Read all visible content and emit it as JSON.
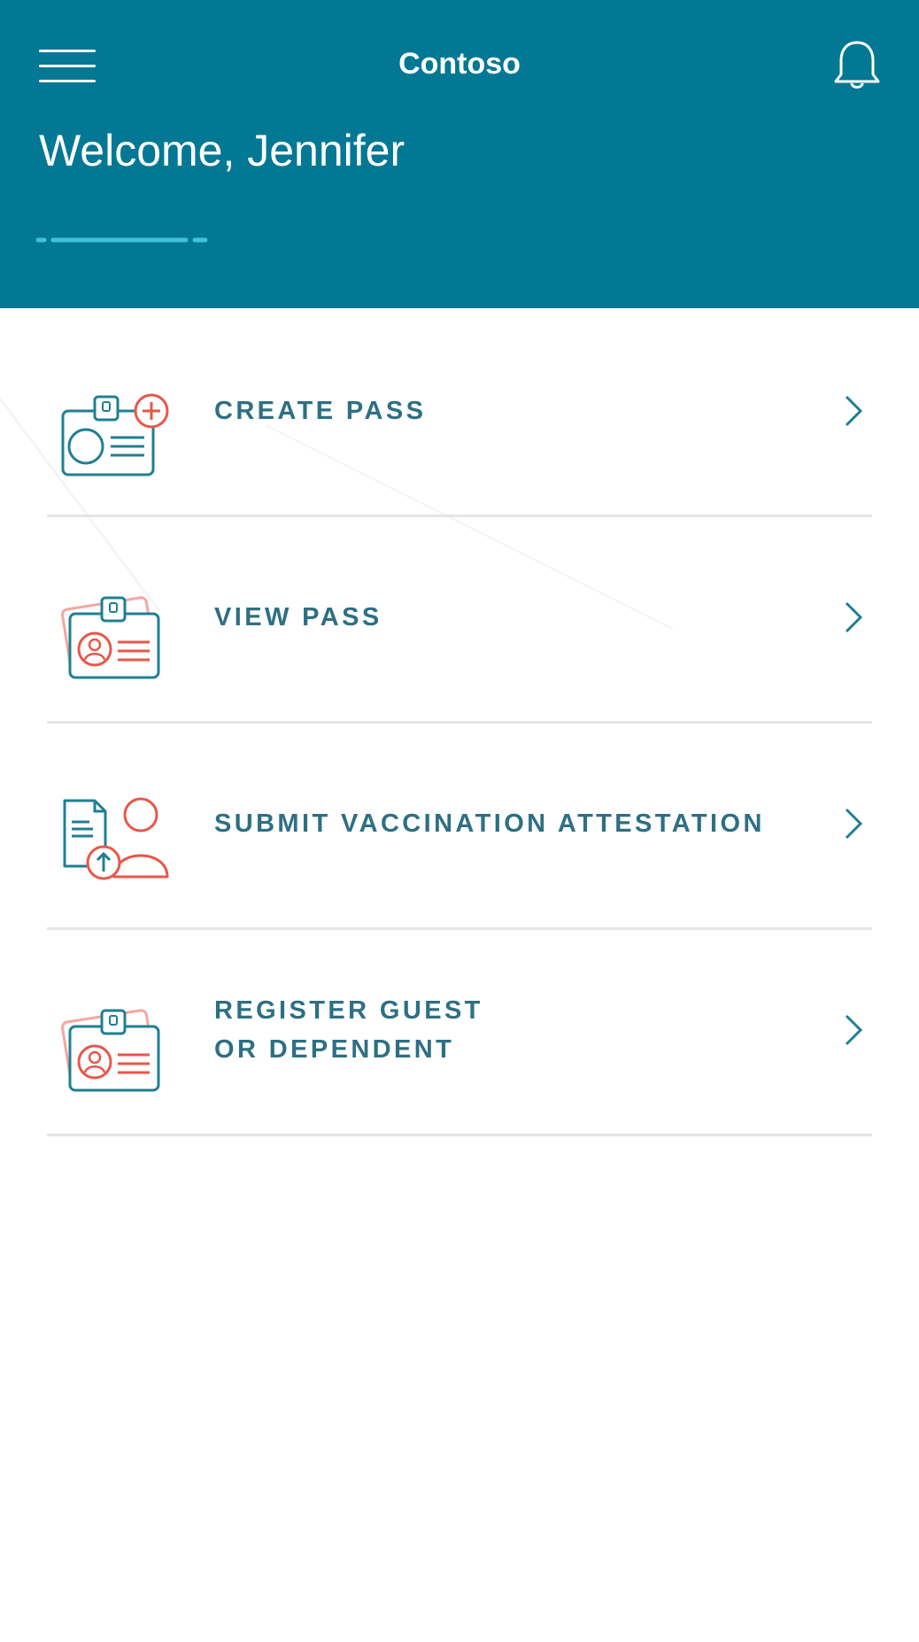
{
  "colors": {
    "header_bg": "#027894",
    "accent_light": "#3fc3dd",
    "teal_icon": "#1f7f93",
    "coral_icon": "#e8574a",
    "label": "#2e6f84",
    "divider": "#e3e5e6"
  },
  "header": {
    "menu_icon": "hamburger-menu-icon",
    "title": "Contoso",
    "notification_icon": "bell-icon",
    "welcome": "Welcome, Jennifer"
  },
  "actions": [
    {
      "label": "CREATE PASS",
      "icon": "create-pass-icon"
    },
    {
      "label": "VIEW PASS",
      "icon": "view-pass-icon"
    },
    {
      "label": "SUBMIT VACCINATION ATTESTATION",
      "icon": "submit-attestation-icon"
    },
    {
      "label": "REGISTER GUEST\nOR DEPENDENT",
      "icon": "register-guest-icon"
    }
  ]
}
